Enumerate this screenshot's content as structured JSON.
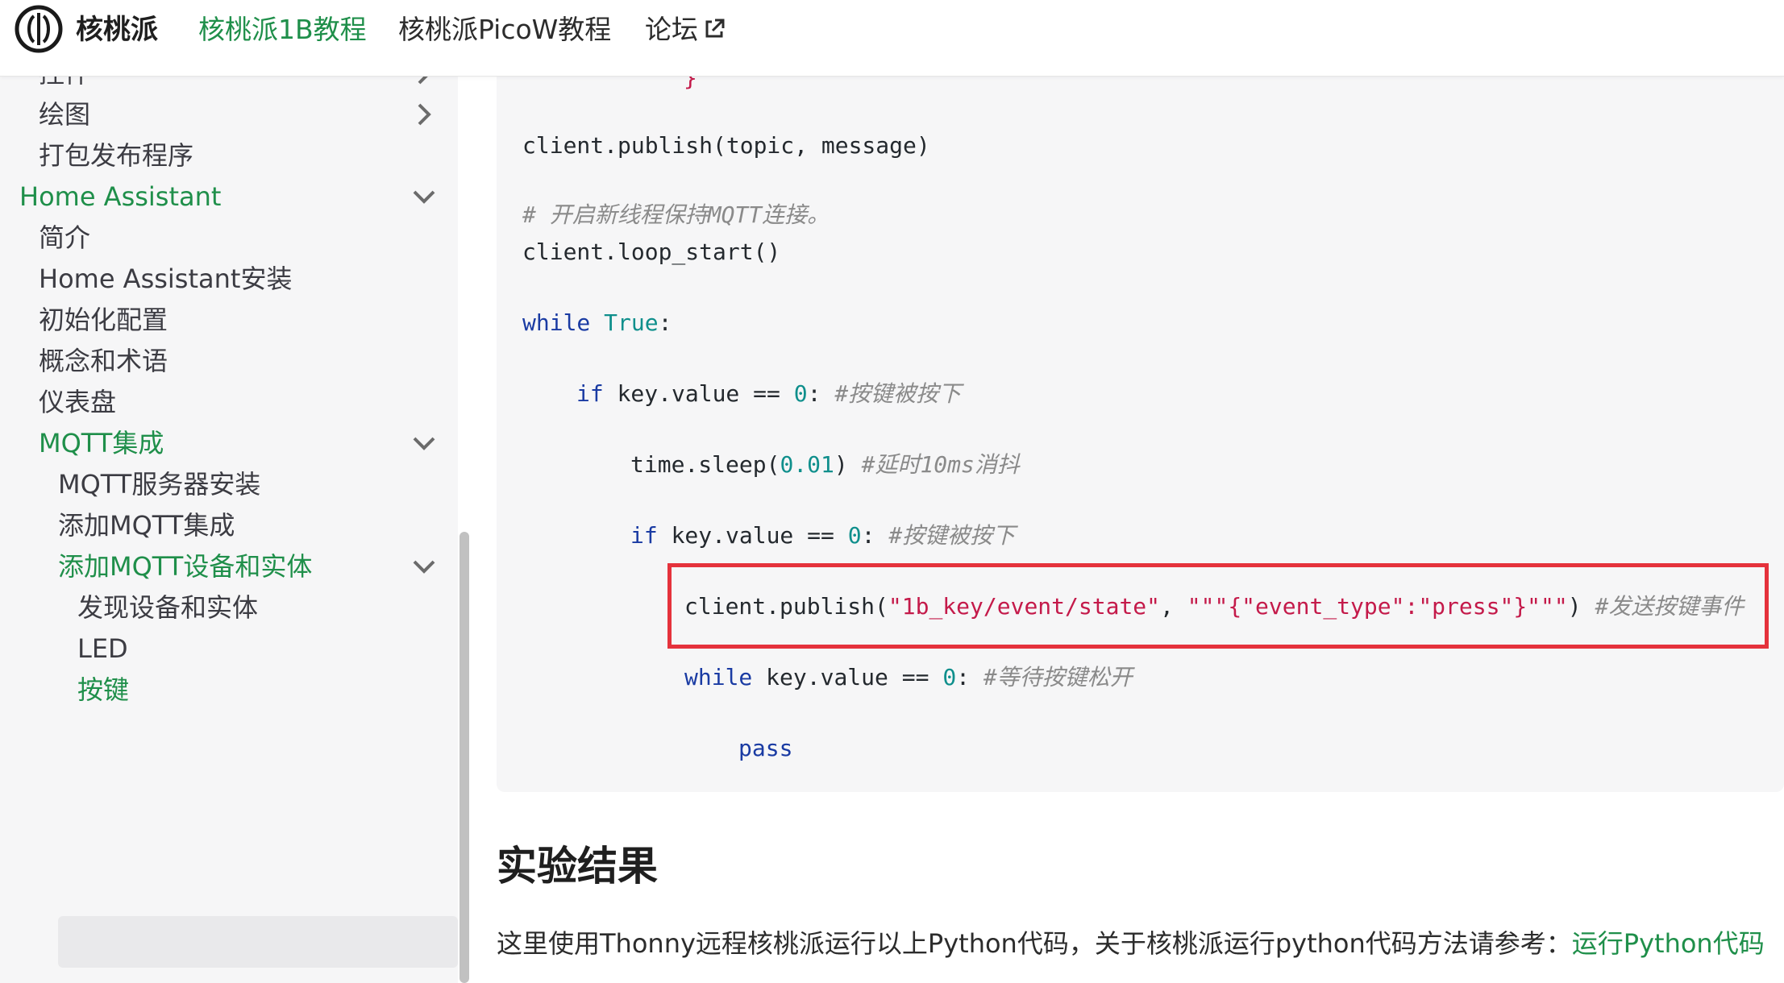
{
  "navbar": {
    "site_title": "核桃派",
    "links": [
      {
        "label": "核桃派1B教程",
        "active": true
      },
      {
        "label": "核桃派PicoW教程",
        "active": false
      },
      {
        "label": "论坛",
        "active": false
      }
    ],
    "external_icon": "external-link-icon",
    "accent_color": "#1f8f4a"
  },
  "sidebar": {
    "items": [
      {
        "label": "控件",
        "level": 1,
        "chevron": "right",
        "green": false
      },
      {
        "label": "绘图",
        "level": 1,
        "chevron": "right",
        "green": false
      },
      {
        "label": "打包发布程序",
        "level": 1,
        "chevron": "",
        "green": false
      },
      {
        "label": "Home Assistant",
        "level": 0,
        "chevron": "down",
        "green": true
      },
      {
        "label": "简介",
        "level": 1,
        "chevron": "",
        "green": false
      },
      {
        "label": "Home Assistant安装",
        "level": 1,
        "chevron": "",
        "green": false
      },
      {
        "label": "初始化配置",
        "level": 1,
        "chevron": "",
        "green": false
      },
      {
        "label": "概念和术语",
        "level": 1,
        "chevron": "",
        "green": false
      },
      {
        "label": "仪表盘",
        "level": 1,
        "chevron": "",
        "green": false
      },
      {
        "label": "MQTT集成",
        "level": 1,
        "chevron": "down",
        "green": true
      },
      {
        "label": "MQTT服务器安装",
        "level": 2,
        "chevron": "",
        "green": false
      },
      {
        "label": "添加MQTT集成",
        "level": 2,
        "chevron": "",
        "green": false
      },
      {
        "label": "添加MQTT设备和实体",
        "level": 2,
        "chevron": "down",
        "green": true
      },
      {
        "label": "发现设备和实体",
        "level": 3,
        "chevron": "",
        "green": false
      },
      {
        "label": "LED",
        "level": 3,
        "chevron": "",
        "green": false
      },
      {
        "label": "按键",
        "level": 3,
        "chevron": "",
        "green": true,
        "active": true
      }
    ]
  },
  "code": {
    "partial_top": "}",
    "l1": "client.publish(topic, message)",
    "l2_comment": "# 开启新线程保持MQTT连接。",
    "l3": "client.loop_start()",
    "l4_kw": "while",
    "l4_bool": "True",
    "l4_rest": ":",
    "l5_kw": "if",
    "l5_mid": " key.value == ",
    "l5_num": "0",
    "l5_colon": ": ",
    "l5_comment": "#按键被按下",
    "l6_a": "time.sleep(",
    "l6_num": "0.01",
    "l6_b": ") ",
    "l6_comment": "#延时10ms消抖",
    "l7_kw": "if",
    "l7_mid": " key.value == ",
    "l7_num": "0",
    "l7_colon": ": ",
    "l7_comment": "#按键被按下",
    "l8_a": "client.publish(",
    "l8_str1": "\"1b_key/event/state\"",
    "l8_b": ", ",
    "l8_str2": "\"\"\"{\"event_type\":\"press\"}\"\"\"",
    "l8_c": ") ",
    "l8_comment": "#发送按键事件",
    "l9_kw": "while",
    "l9_mid": " key.value == ",
    "l9_num": "0",
    "l9_colon": ": ",
    "l9_comment": "#等待按键松开",
    "l10_kw": "pass",
    "highlight_color": "#e5323c"
  },
  "main": {
    "section_title": "实验结果",
    "para_text": "这里使用Thonny远程核桃派运行以上Python代码，关于核桃派运行python代码方法请参考：",
    "para_link": "运行Python代码"
  }
}
